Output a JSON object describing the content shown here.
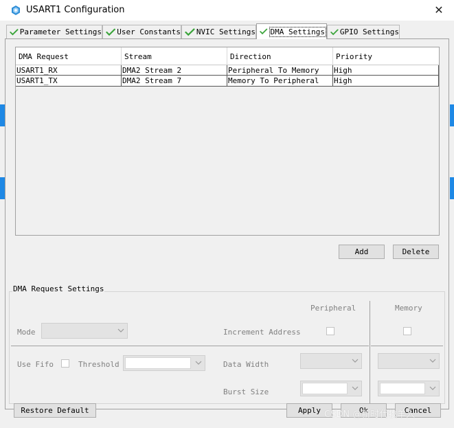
{
  "window": {
    "title": "USART1 Configuration",
    "close_glyph": "✕"
  },
  "tabs": [
    {
      "label": "Parameter Settings",
      "icon": "checkmark-icon",
      "active": false
    },
    {
      "label": "User Constants",
      "icon": "checkmark-icon",
      "active": false
    },
    {
      "label": "NVIC Settings",
      "icon": "checkmark-icon",
      "active": false
    },
    {
      "label": "DMA Settings",
      "icon": "checkmark-icon",
      "active": true
    },
    {
      "label": "GPIO Settings",
      "icon": "checkmark-icon",
      "active": false
    }
  ],
  "dma_table": {
    "columns": [
      "DMA Request",
      "Stream",
      "Direction",
      "Priority"
    ],
    "rows": [
      [
        "USART1_RX",
        "DMA2 Stream 2",
        "Peripheral To Memory",
        "High"
      ],
      [
        "USART1_TX",
        "DMA2 Stream 7",
        "Memory To Peripheral",
        "High"
      ]
    ]
  },
  "table_buttons": {
    "add": "Add",
    "delete": "Delete"
  },
  "request_settings": {
    "title": "DMA Request Settings",
    "peripheral_header": "Peripheral",
    "memory_header": "Memory",
    "mode_label": "Mode",
    "increment_address_label": "Increment Address",
    "use_fifo_label": "Use Fifo",
    "threshold_label": "Threshold",
    "data_width_label": "Data Width",
    "burst_size_label": "Burst Size"
  },
  "footer": {
    "restore_default": "Restore Default",
    "apply": "Apply",
    "ok": "Ok",
    "cancel": "Cancel"
  },
  "watermark": "CSDN @新时代牧羊人",
  "colors": {
    "check_green": "#3aa43a",
    "accent_blue": "#1e88e5"
  }
}
